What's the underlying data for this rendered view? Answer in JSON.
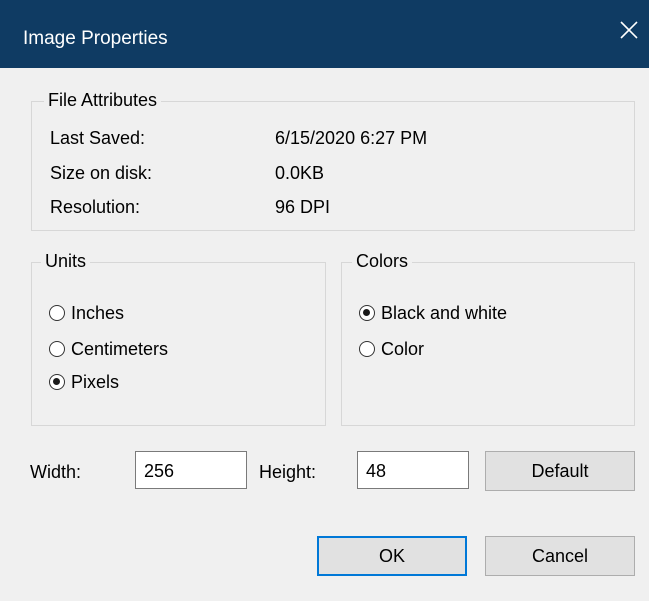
{
  "window": {
    "title": "Image Properties",
    "close_icon": "close-icon"
  },
  "file_attributes": {
    "label": "File Attributes",
    "rows": [
      {
        "label": "Last Saved:",
        "value": "6/15/2020 6:27 PM"
      },
      {
        "label": "Size on disk:",
        "value": "0.0KB"
      },
      {
        "label": "Resolution:",
        "value": "96 DPI"
      }
    ]
  },
  "units": {
    "label": "Units",
    "options": [
      {
        "label": "Inches",
        "checked": false
      },
      {
        "label": "Centimeters",
        "checked": false
      },
      {
        "label": "Pixels",
        "checked": true
      }
    ]
  },
  "colors": {
    "label": "Colors",
    "options": [
      {
        "label": "Black and white",
        "checked": true
      },
      {
        "label": "Color",
        "checked": false
      }
    ]
  },
  "dimensions": {
    "width_label": "Width:",
    "width_value": "256",
    "height_label": "Height:",
    "height_value": "48",
    "default_label": "Default"
  },
  "buttons": {
    "ok_label": "OK",
    "cancel_label": "Cancel"
  },
  "theme": {
    "titlebar": "#0f3b63",
    "dialog_bg": "#f0f0f0",
    "focus_border": "#0078d7"
  }
}
